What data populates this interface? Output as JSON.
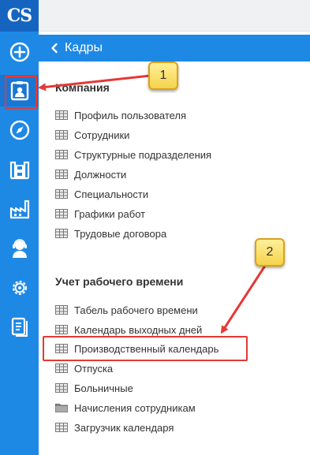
{
  "app": {
    "logo": "CS",
    "accent": "#1e88e5",
    "alert": "#e53935"
  },
  "rail": [
    {
      "icon": "plus-circle-icon"
    },
    {
      "icon": "id-badge-icon",
      "active": true
    },
    {
      "icon": "compass-icon"
    },
    {
      "icon": "warehouse-icon"
    },
    {
      "icon": "factory-icon"
    },
    {
      "icon": "support-agent-icon"
    },
    {
      "icon": "gear-icon"
    },
    {
      "icon": "document-icon"
    }
  ],
  "panel": {
    "title": "Кадры"
  },
  "sections": [
    {
      "title": "Компания",
      "items": [
        {
          "label": "Профиль пользователя",
          "icon": "table-icon"
        },
        {
          "label": "Сотрудники",
          "icon": "table-icon"
        },
        {
          "label": "Структурные подразделения",
          "icon": "table-icon"
        },
        {
          "label": "Должности",
          "icon": "table-icon"
        },
        {
          "label": "Специальности",
          "icon": "table-icon"
        },
        {
          "label": "Графики работ",
          "icon": "table-icon"
        },
        {
          "label": "Трудовые договора",
          "icon": "table-icon"
        }
      ]
    },
    {
      "title": "Учет рабочего времени",
      "items": [
        {
          "label": "Табель рабочего времени",
          "icon": "table-icon"
        },
        {
          "label": "Календарь выходных дней",
          "icon": "table-icon"
        },
        {
          "label": "Производственный календарь",
          "icon": "table-icon",
          "highlighted": true
        },
        {
          "label": "Отпуска",
          "icon": "table-icon"
        },
        {
          "label": "Больничные",
          "icon": "table-icon"
        },
        {
          "label": "Начисления сотрудникам",
          "icon": "folder-icon"
        },
        {
          "label": "Загрузчик календаря",
          "icon": "table-icon"
        }
      ]
    }
  ],
  "callouts": [
    "1",
    "2"
  ]
}
